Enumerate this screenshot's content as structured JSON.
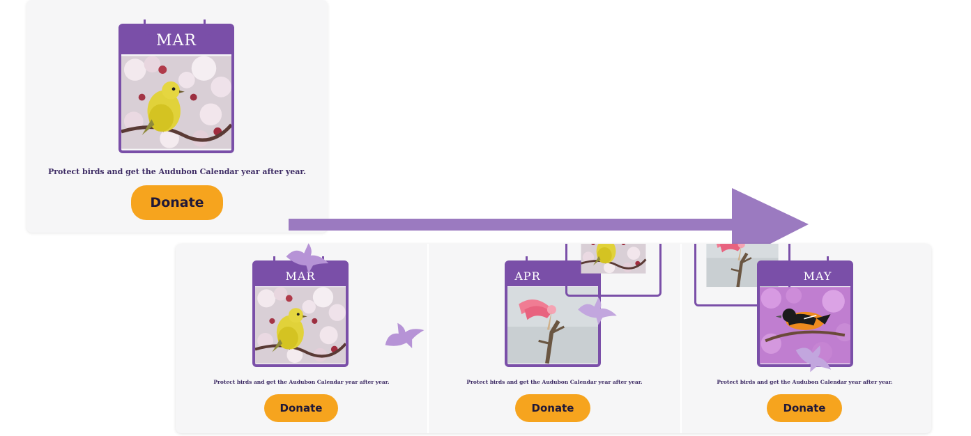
{
  "colors": {
    "brand_purple": "#7a4fa8",
    "donate_orange": "#f6a41e",
    "tagline_text": "#3c2a63",
    "arrow_purple": "#9b7ac0"
  },
  "hero_card": {
    "month": "MAR",
    "photo": "yellow-warbler-photo",
    "tagline": "Protect birds and get the Audubon Calendar year after year.",
    "donate_label": "Donate"
  },
  "sequence": [
    {
      "month": "MAR",
      "photo": "yellow-warbler-photo",
      "tagline": "Protect birds and get the Audubon Calendar year after year.",
      "donate_label": "Donate"
    },
    {
      "month": "APR",
      "photo": "roseate-spoonbill-photo",
      "tagline": "Protect birds and get the Audubon Calendar year after year.",
      "donate_label": "Donate"
    },
    {
      "month": "MAY",
      "photo": "baltimore-oriole-photo",
      "tagline": "Protect birds and get the Audubon Calendar year after year.",
      "donate_label": "Donate"
    }
  ],
  "icons": {
    "arrow": "right-arrow-icon",
    "flying_bird": "bird-silhouette-icon"
  }
}
